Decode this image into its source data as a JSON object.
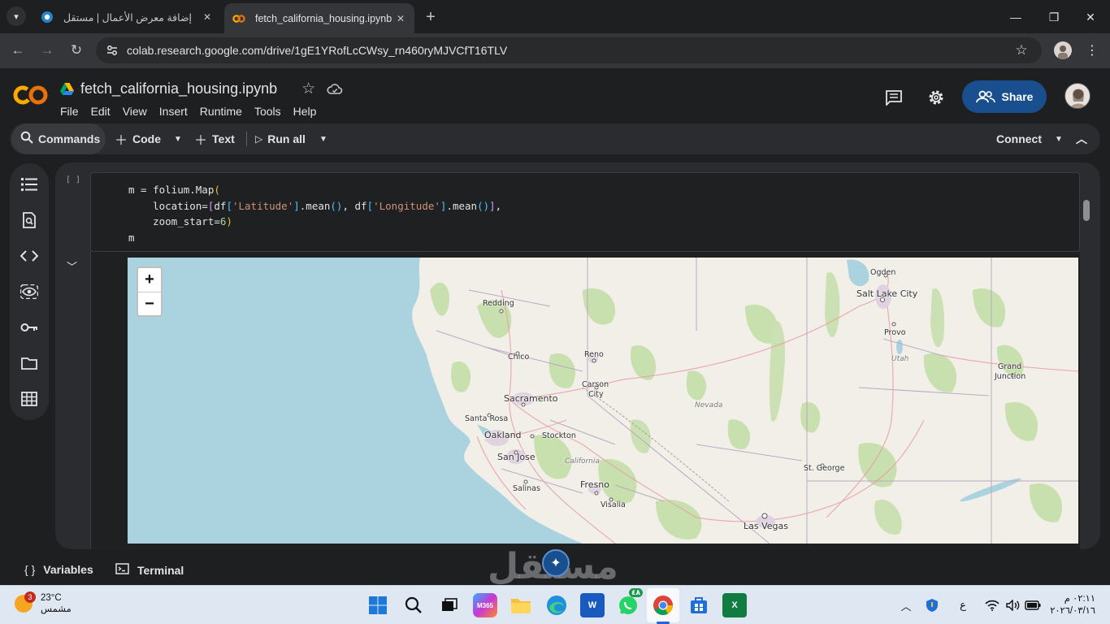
{
  "browser": {
    "tabs": [
      {
        "title": "إضافة معرض الأعمال | مستقل",
        "close": "✕",
        "icon": "mostaql-favicon-icon"
      },
      {
        "title": "fetch_california_housing.ipynb -",
        "close": "✕",
        "icon": "colab-favicon-icon"
      }
    ],
    "url": "colab.research.google.com/drive/1gE1YRofLcCWsy_rn460ryMJVCfT16TLV"
  },
  "colab": {
    "notebook_title": "fetch_california_housing.ipynb",
    "menu": [
      "File",
      "Edit",
      "View",
      "Insert",
      "Runtime",
      "Tools",
      "Help"
    ],
    "share_label": "Share",
    "commands_label": "Commands",
    "code_label": "Code",
    "text_label": "Text",
    "run_all_label": "Run all",
    "connect_label": "Connect",
    "cell": {
      "exec_count": "[ ]",
      "code_lines": [
        "m = folium.Map(",
        "    location=[df['Latitude'].mean(), df['Longitude'].mean()],",
        "    zoom_start=6)",
        "m"
      ]
    },
    "bottom": {
      "variables_label": "Variables",
      "terminal_label": "Terminal"
    }
  },
  "map": {
    "zoom_in": "+",
    "zoom_out": "−",
    "places": {
      "ogden": "Ogden",
      "salt_lake": "Salt Lake City",
      "provo": "Provo",
      "utah": "Utah",
      "grand_junction_1": "Grand",
      "grand_junction_2": "Junction",
      "redding": "Redding",
      "chico": "Chico",
      "reno": "Reno",
      "carson_1": "Carson",
      "carson_2": "City",
      "sacramento": "Sacramento",
      "nevada": "Nevada",
      "santa_rosa": "Santa Rosa",
      "oakland": "Oakland",
      "stockton": "Stockton",
      "san_jose": "San Jose",
      "california": "California",
      "st_george": "St. George",
      "salinas": "Salinas",
      "fresno": "Fresno",
      "visalia": "Visalia",
      "las_vegas": "Las Vegas"
    }
  },
  "overlay": {
    "watermark": "مستقل"
  },
  "taskbar": {
    "weather_temp": "23°C",
    "weather_desc": "مشمس",
    "weather_badge": "3",
    "whatsapp_badge": "٤٨",
    "lang": "ع",
    "time": "٠٢:١١ م",
    "date": "٢٠٢٦/٠٣/١٦",
    "apps": [
      "windows-start",
      "search",
      "task-view",
      "m365",
      "file-explorer",
      "edge",
      "word",
      "whatsapp",
      "chrome",
      "store",
      "excel"
    ]
  }
}
